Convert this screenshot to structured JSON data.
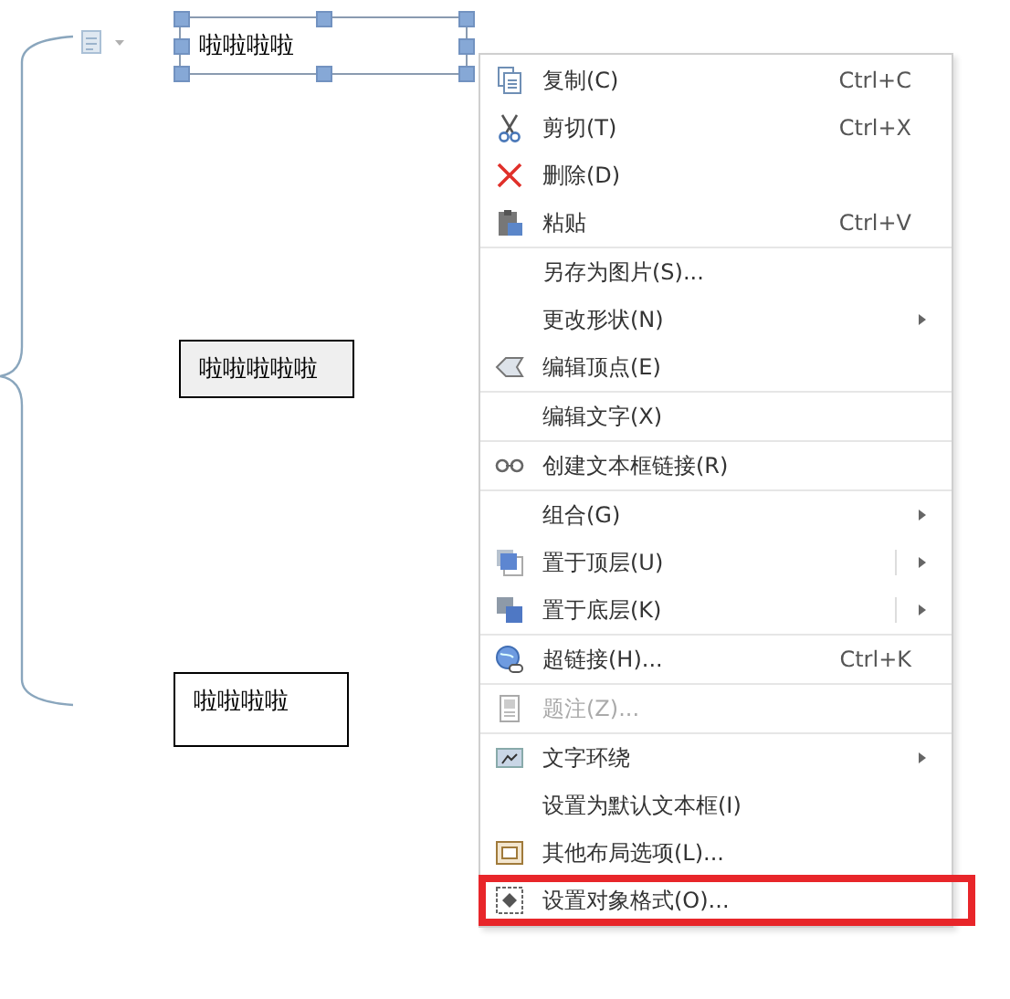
{
  "canvas": {
    "shapes": [
      {
        "text": "啦啦啦啦",
        "selected": true,
        "shaded": false
      },
      {
        "text": "啦啦啦啦啦",
        "selected": false,
        "shaded": true
      },
      {
        "text": "啦啦啦啦",
        "selected": false,
        "shaded": false
      }
    ]
  },
  "context_menu": {
    "items": [
      {
        "kind": "copy",
        "label": "复制(C)",
        "shortcut": "Ctrl+C",
        "submenu": false,
        "split": false,
        "disabled": false,
        "separator_after": false,
        "annotated": false
      },
      {
        "kind": "cut",
        "label": "剪切(T)",
        "shortcut": "Ctrl+X",
        "submenu": false,
        "split": false,
        "disabled": false,
        "separator_after": false,
        "annotated": false
      },
      {
        "kind": "delete",
        "label": "删除(D)",
        "submenu": false,
        "split": false,
        "disabled": false,
        "separator_after": false,
        "annotated": false
      },
      {
        "kind": "paste",
        "label": "粘贴",
        "shortcut": "Ctrl+V",
        "submenu": false,
        "split": false,
        "disabled": false,
        "separator_after": true,
        "annotated": false
      },
      {
        "kind": "plain",
        "label": "另存为图片(S)...",
        "submenu": false,
        "split": false,
        "disabled": false,
        "separator_after": false,
        "annotated": false
      },
      {
        "kind": "plain",
        "label": "更改形状(N)",
        "submenu": true,
        "split": false,
        "disabled": false,
        "separator_after": false,
        "annotated": false
      },
      {
        "kind": "points",
        "label": "编辑顶点(E)",
        "submenu": false,
        "split": false,
        "disabled": false,
        "separator_after": true,
        "annotated": false
      },
      {
        "kind": "plain",
        "label": "编辑文字(X)",
        "submenu": false,
        "split": false,
        "disabled": false,
        "separator_after": true,
        "annotated": false
      },
      {
        "kind": "chain",
        "label": "创建文本框链接(R)",
        "submenu": false,
        "split": false,
        "disabled": false,
        "separator_after": true,
        "annotated": false
      },
      {
        "kind": "plain",
        "label": "组合(G)",
        "submenu": true,
        "split": false,
        "disabled": false,
        "separator_after": false,
        "annotated": false
      },
      {
        "kind": "front",
        "label": "置于顶层(U)",
        "submenu": true,
        "split": true,
        "disabled": false,
        "separator_after": false,
        "annotated": false
      },
      {
        "kind": "back",
        "label": "置于底层(K)",
        "submenu": true,
        "split": true,
        "disabled": false,
        "separator_after": true,
        "annotated": false
      },
      {
        "kind": "hyperlink",
        "label": "超链接(H)...",
        "shortcut": "Ctrl+K",
        "submenu": false,
        "split": false,
        "disabled": false,
        "separator_after": true,
        "annotated": false
      },
      {
        "kind": "caption",
        "label": "题注(Z)...",
        "submenu": false,
        "split": false,
        "disabled": true,
        "separator_after": true,
        "annotated": false
      },
      {
        "kind": "wrap",
        "label": "文字环绕",
        "submenu": true,
        "split": false,
        "disabled": false,
        "separator_after": false,
        "annotated": false
      },
      {
        "kind": "plain",
        "label": "设置为默认文本框(I)",
        "submenu": false,
        "split": false,
        "disabled": false,
        "separator_after": false,
        "annotated": false
      },
      {
        "kind": "layout",
        "label": "其他布局选项(L)...",
        "submenu": false,
        "split": false,
        "disabled": false,
        "separator_after": false,
        "annotated": false
      },
      {
        "kind": "format",
        "label": "设置对象格式(O)...",
        "submenu": false,
        "split": false,
        "disabled": false,
        "separator_after": false,
        "annotated": true
      }
    ]
  }
}
